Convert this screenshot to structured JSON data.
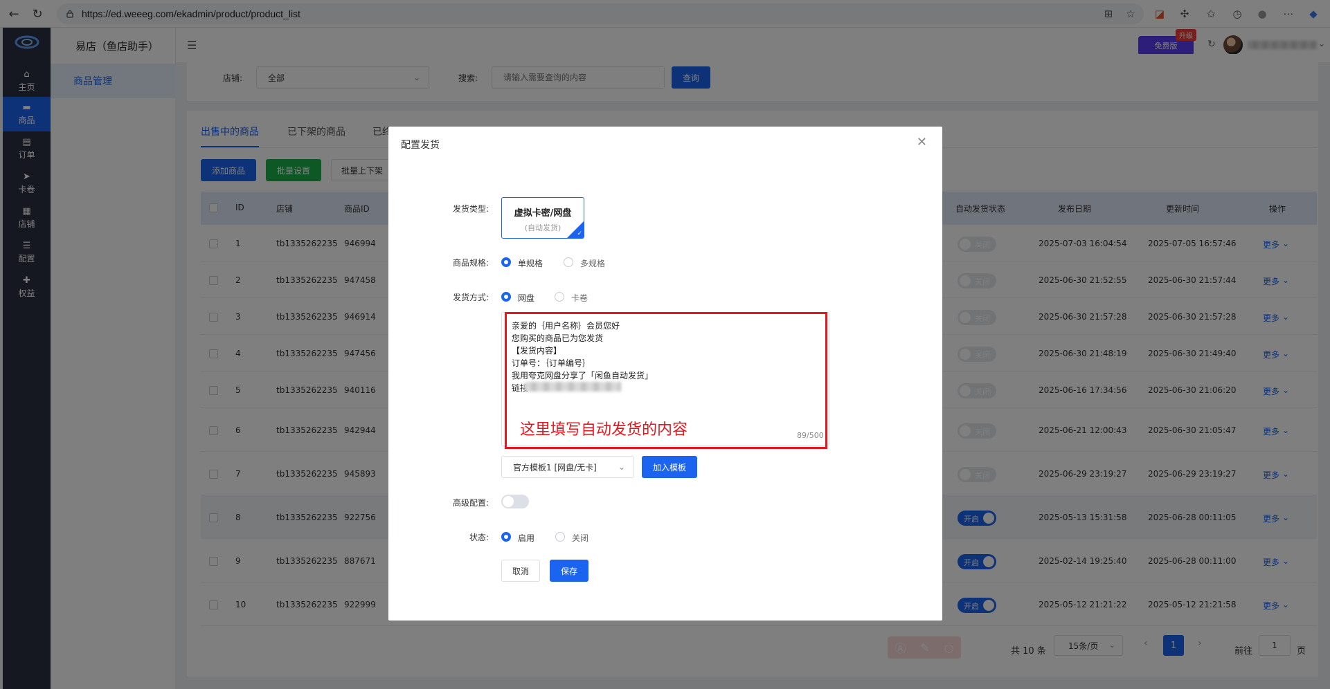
{
  "browser": {
    "url": "https://ed.weeeg.com/ekadmin/product/product_list"
  },
  "rail": {
    "items": [
      {
        "label": "主页",
        "icon": "home-icon",
        "glyph": "⌂"
      },
      {
        "label": "商品",
        "icon": "product-icon",
        "glyph": "▬"
      },
      {
        "label": "订单",
        "icon": "order-icon",
        "glyph": "▤"
      },
      {
        "label": "卡卷",
        "icon": "send-icon",
        "glyph": "➤"
      },
      {
        "label": "店铺",
        "icon": "grid-icon",
        "glyph": "▦"
      },
      {
        "label": "配置",
        "icon": "sliders-icon",
        "glyph": "☰"
      },
      {
        "label": "权益",
        "icon": "thumb-icon",
        "glyph": "✚"
      }
    ],
    "active_index": 1
  },
  "submenu": {
    "app_title": "易店（鱼店助手）",
    "active_item": "商品管理"
  },
  "topbar": {
    "free_label": "免费版",
    "upgrade_badge": "升级"
  },
  "filter": {
    "store_label": "店铺:",
    "store_value": "全部",
    "search_label": "搜索:",
    "search_placeholder": "请输入需要查询的内容",
    "query_label": "查询"
  },
  "tabs": [
    {
      "label": "出售中的商品",
      "active": true
    },
    {
      "label": "已下架的商品",
      "active": false
    },
    {
      "label": "已终",
      "active": false
    }
  ],
  "toolbar": {
    "add_label": "添加商品",
    "batch_label": "批量设置",
    "updown_label": "批量上下架"
  },
  "table": {
    "headers": {
      "id": "ID",
      "store": "店铺",
      "product_id": "商品ID",
      "auto_status": "自动发货状态",
      "publish_date": "发布日期",
      "update_time": "更新时间",
      "action": "操作"
    },
    "rows": [
      {
        "id": "1",
        "store": "tb1335262235",
        "pid": "946994",
        "status": "off",
        "status_label": "关闭",
        "publish": "2025-07-03 16:04:54",
        "update": "2025-07-05 16:57:46",
        "more": "更多"
      },
      {
        "id": "2",
        "store": "tb1335262235",
        "pid": "947458",
        "status": "off",
        "status_label": "关闭",
        "publish": "2025-06-30 21:52:55",
        "update": "2025-06-30 21:57:44",
        "more": "更多"
      },
      {
        "id": "3",
        "store": "tb1335262235",
        "pid": "946914",
        "status": "off",
        "status_label": "关闭",
        "publish": "2025-06-30 21:57:28",
        "update": "2025-06-30 21:57:28",
        "more": "更多"
      },
      {
        "id": "4",
        "store": "tb1335262235",
        "pid": "947456",
        "status": "off",
        "status_label": "关闭",
        "publish": "2025-06-30 21:48:19",
        "update": "2025-06-30 21:49:40",
        "more": "更多"
      },
      {
        "id": "5",
        "store": "tb1335262235",
        "pid": "940116",
        "status": "off",
        "status_label": "关闭",
        "publish": "2025-06-16 17:34:56",
        "update": "2025-06-30 21:06:20",
        "more": "更多"
      },
      {
        "id": "6",
        "store": "tb1335262235",
        "pid": "942944",
        "status": "off",
        "status_label": "关闭",
        "publish": "2025-06-21 12:00:43",
        "update": "2025-06-30 21:05:47",
        "more": "更多"
      },
      {
        "id": "7",
        "store": "tb1335262235",
        "pid": "945893",
        "status": "off",
        "status_label": "关闭",
        "publish": "2025-06-29 23:19:27",
        "update": "2025-06-29 23:19:27",
        "more": "更多"
      },
      {
        "id": "8",
        "store": "tb1335262235",
        "pid": "922756",
        "status": "on",
        "status_label": "开启",
        "publish": "2025-05-13 15:31:58",
        "update": "2025-06-28 00:11:05",
        "more": "更多"
      },
      {
        "id": "9",
        "store": "tb1335262235",
        "pid": "887671",
        "status": "on",
        "status_label": "开启",
        "publish": "2025-02-14 19:25:40",
        "update": "2025-06-28 00:11:00",
        "more": "更多"
      },
      {
        "id": "10",
        "store": "tb1335262235",
        "pid": "922999",
        "status": "on",
        "status_label": "开启",
        "publish": "2025-05-12 21:21:22",
        "update": "2025-05-12 21:21:58",
        "more": "更多"
      }
    ]
  },
  "pagination": {
    "total": "共 10 条",
    "page_size": "15条/页",
    "current": "1",
    "goto_label": "前往",
    "goto_value": "1",
    "unit": "页"
  },
  "modal": {
    "title": "配置发货",
    "type_label": "发货类型:",
    "type_card_title": "虚拟卡密/网盘",
    "type_card_sub": "(自动发货)",
    "spec_label": "商品规格:",
    "spec_options": [
      "单规格",
      "多规格"
    ],
    "method_label": "发货方式:",
    "method_options": [
      "网盘",
      "卡卷"
    ],
    "content_lines": [
      "亲爱的｛用户名称｝会员您好",
      "您购买的商品已为您发货",
      "【发货内容】",
      "订单号：｛订单编号｝",
      "我用夸克网盘分享了「闲鱼自动发货」",
      "链接"
    ],
    "annotation": "这里填写自动发货的内容",
    "counter": "89/500",
    "template_value": "官方模板1 [网盘/无卡]",
    "add_template_label": "加入模板",
    "advanced_label": "高级配置:",
    "status_label": "状态:",
    "status_options": [
      "启用",
      "关闭"
    ],
    "cancel_label": "取消",
    "save_label": "保存"
  }
}
